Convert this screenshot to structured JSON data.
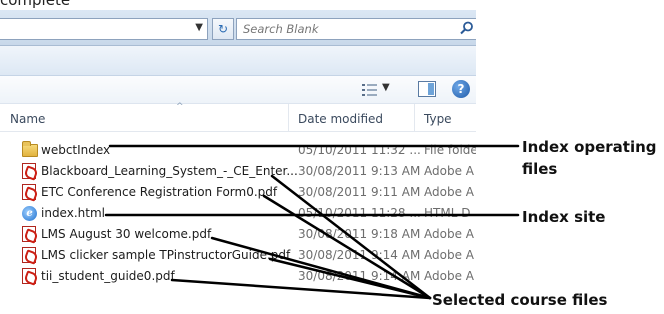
{
  "top_text": "complete",
  "search": {
    "placeholder": "Search Blank"
  },
  "columns": {
    "name": "Name",
    "date": "Date modified",
    "type": "Type"
  },
  "files": [
    {
      "name": "webctIndex",
      "date": "05/10/2011 11:32 ...",
      "type": "File folde",
      "icon": "folder-icon"
    },
    {
      "name": "Blackboard_Learning_System_-_CE_Enter...",
      "date": "30/08/2011 9:13 AM",
      "type": "Adobe A",
      "icon": "pdf-icon"
    },
    {
      "name": "ETC Conference Registration Form0.pdf",
      "date": "30/08/2011 9:11 AM",
      "type": "Adobe A",
      "icon": "pdf-icon"
    },
    {
      "name": "index.html",
      "date": "05/10/2011 11:28 ...",
      "type": "HTML D",
      "icon": "html-icon"
    },
    {
      "name": "LMS August 30 welcome.pdf",
      "date": "30/08/2011 9:18 AM",
      "type": "Adobe A",
      "icon": "pdf-icon"
    },
    {
      "name": "LMS clicker sample TPinstructorGuide.pdf",
      "date": "30/08/2011 9:14 AM",
      "type": "Adobe A",
      "icon": "pdf-icon"
    },
    {
      "name": "tii_student_guide0.pdf",
      "date": "30/08/2011 9:14 AM",
      "type": "Adobe A",
      "icon": "pdf-icon"
    }
  ],
  "callouts": {
    "operating_line1": "Index operating",
    "operating_line2": "files",
    "site": "Index site",
    "course": "Selected course files"
  },
  "colors": {
    "accent": "#2a6bb3",
    "pdf_red": "#cc1f14",
    "folder": "#e2b33f",
    "callout_line": "#000000"
  }
}
